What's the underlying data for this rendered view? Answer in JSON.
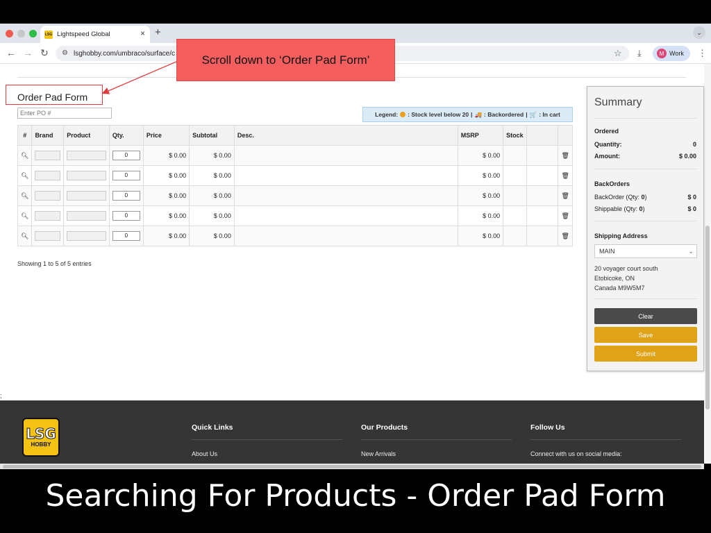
{
  "browser": {
    "tab_title": "Lightspeed Global",
    "favicon_text": "LSG",
    "url": "lsghobby.com/umbraco/surface/c",
    "profile_initial": "M",
    "profile_label": "Work"
  },
  "annotation": {
    "callout_text": "Scroll down to ‘Order Pad Form’",
    "caption": "Searching For Products - Order Pad Form"
  },
  "order_pad": {
    "title": "Order Pad Form",
    "po_placeholder": "Enter PO #",
    "legend": {
      "label": "Legend:",
      "stock": ": Stock level below 20",
      "backordered": ": Backordered",
      "in_cart": ": In cart"
    },
    "columns": [
      "#",
      "Brand",
      "Product",
      "Qty.",
      "Price",
      "Subtotal",
      "Desc.",
      "MSRP",
      "Stock"
    ],
    "rows": [
      {
        "qty": "0",
        "price": "$ 0.00",
        "subtotal": "$ 0.00",
        "msrp": "$ 0.00"
      },
      {
        "qty": "0",
        "price": "$ 0.00",
        "subtotal": "$ 0.00",
        "msrp": "$ 0.00"
      },
      {
        "qty": "0",
        "price": "$ 0.00",
        "subtotal": "$ 0.00",
        "msrp": "$ 0.00"
      },
      {
        "qty": "0",
        "price": "$ 0.00",
        "subtotal": "$ 0.00",
        "msrp": "$ 0.00"
      },
      {
        "qty": "0",
        "price": "$ 0.00",
        "subtotal": "$ 0.00",
        "msrp": "$ 0.00"
      }
    ],
    "entries_text": "Showing 1 to 5 of 5 entries",
    "stray_text": ";"
  },
  "summary": {
    "title": "Summary",
    "ordered_heading": "Ordered",
    "quantity_label": "Quantity:",
    "quantity_value": "0",
    "amount_label": "Amount:",
    "amount_value": "$ 0.00",
    "backorders_heading": "BackOrders",
    "backorder_label": "BackOrder (Qty: ",
    "backorder_qty": "0",
    "backorder_value": "$ 0",
    "shippable_label": "Shippable (Qty: ",
    "shippable_qty": "0",
    "shippable_value": "$ 0",
    "shipping_heading": "Shipping Address",
    "shipping_selected": "MAIN",
    "address_line1": "20 voyager court south",
    "address_line2": "Etobicoke, ON",
    "address_line3": "Canada M9W5M7",
    "clear_label": "Clear",
    "save_label": "Save",
    "submit_label": "Submit"
  },
  "footer": {
    "logo_big": "LSG",
    "logo_small": "HOBBY",
    "quick_links_title": "Quick Links",
    "quick_links_first": "About Us",
    "products_title": "Our Products",
    "products_first": "New Arrivals",
    "follow_title": "Follow Us",
    "follow_text": "Connect with us on social media:"
  },
  "colors": {
    "accent_button": "#e0a216",
    "clear_button": "#4a4a4a",
    "callout": "#f55e5e",
    "footer": "#353535"
  }
}
